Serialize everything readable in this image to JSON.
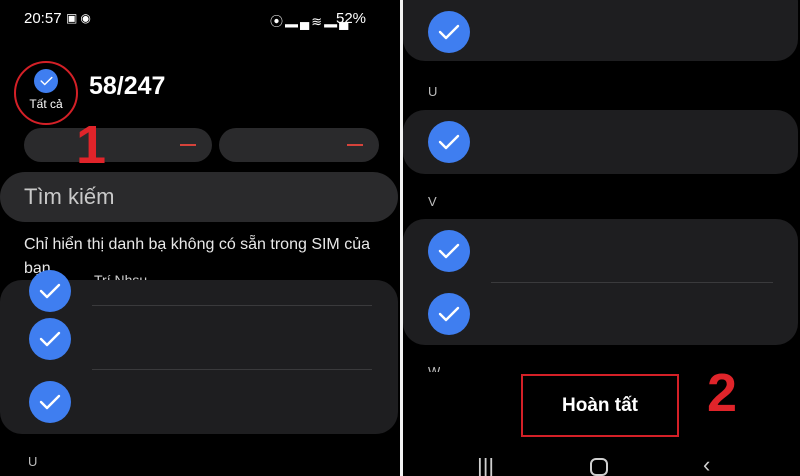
{
  "left_screen": {
    "status_bar": {
      "time": "20:57",
      "notification_icons": [
        "image-icon",
        "messenger-icon"
      ],
      "system_icons": [
        "hotspot-icon",
        "signal-icon",
        "wifi-icon",
        "signal-icon"
      ],
      "battery": "52%"
    },
    "select_all_label": "Tất cả",
    "count": "58/247",
    "annotation_1": "1",
    "search_placeholder": "Tìm kiếm",
    "info_text": "Chỉ hiển thị danh bạ không có sẵn trong SIM của bạn.",
    "partial_contact_name": "Trí Nhsu",
    "section_letter": "U"
  },
  "right_screen": {
    "section_letters": [
      "U",
      "V",
      "W"
    ],
    "done_label": "Hoàn tất",
    "annotation_2": "2",
    "nav_icons": [
      "recent-apps-icon",
      "home-icon",
      "back-icon"
    ]
  },
  "colors": {
    "accent": "#3f7ef0",
    "highlight": "#d42027",
    "card": "#1e1e20",
    "pill": "#2a2a2c"
  }
}
